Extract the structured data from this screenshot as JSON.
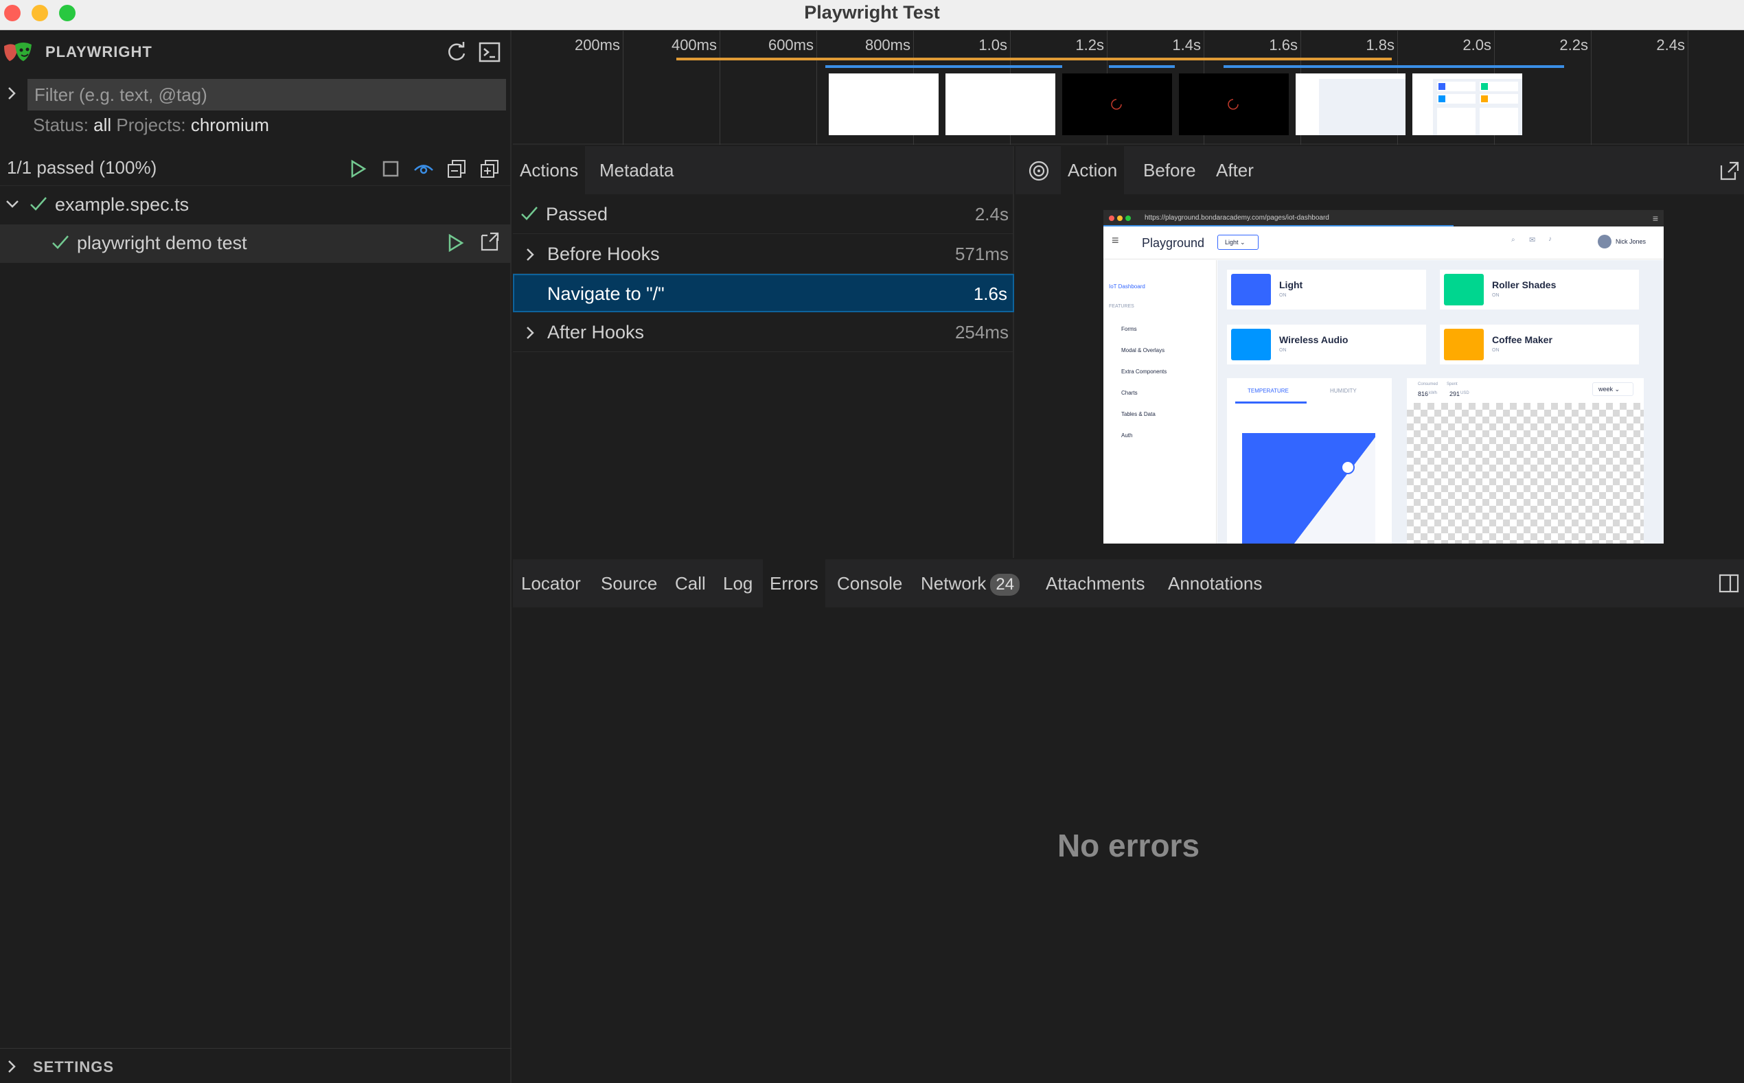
{
  "window": {
    "title": "Playwright Test"
  },
  "sidebar": {
    "brand": "PLAYWRIGHT",
    "filter_placeholder": "Filter (e.g. text, @tag)",
    "status_label": "Status:",
    "status_value": "all",
    "projects_label": "Projects:",
    "projects_value": "chromium",
    "summary": "1/1 passed (100%)",
    "tree": [
      {
        "label": "example.spec.ts",
        "status": "passed"
      },
      {
        "label": "playwright demo test",
        "status": "passed"
      }
    ],
    "settings_label": "SETTINGS"
  },
  "timeline": {
    "ticks": [
      "200ms",
      "400ms",
      "600ms",
      "800ms",
      "1.0s",
      "1.2s",
      "1.4s",
      "1.6s",
      "1.8s",
      "2.0s",
      "2.2s",
      "2.4s"
    ],
    "accent_orange": "#e09b36",
    "accent_blue": "#3a8ee6"
  },
  "actions_panel": {
    "tabs": [
      "Actions",
      "Metadata"
    ],
    "rows": [
      {
        "label": "Passed",
        "duration": "2.4s"
      },
      {
        "label": "Before Hooks",
        "duration": "571ms"
      },
      {
        "label": "Navigate to \"/\"",
        "duration": "1.6s"
      },
      {
        "label": "After Hooks",
        "duration": "254ms"
      }
    ],
    "selected_color": "#04395e"
  },
  "snapshot_panel": {
    "tabs": [
      "Action",
      "Before",
      "After"
    ],
    "page": {
      "url": "https://playground.bondaracademy.com/pages/iot-dashboard",
      "app_title": "Playground",
      "theme_select": "Light",
      "user": "Nick Jones",
      "side_menu": [
        "IoT Dashboard",
        "FEATURES",
        "Forms",
        "Modal & Overlays",
        "Extra Components",
        "Charts",
        "Tables & Data",
        "Auth"
      ],
      "cards": [
        {
          "title": "Light",
          "state": "ON"
        },
        {
          "title": "Roller Shades",
          "state": "ON"
        },
        {
          "title": "Wireless Audio",
          "state": "ON"
        },
        {
          "title": "Coffee Maker",
          "state": "ON"
        }
      ],
      "temp_tabs": [
        "TEMPERATURE",
        "HUMIDITY"
      ],
      "consumed_label": "Consumed",
      "spent_label": "Spent",
      "consumed_value": "816",
      "consumed_unit": "kWh",
      "spent_value": "291",
      "spent_unit": "USD",
      "period_select": "week"
    }
  },
  "bottom_panel": {
    "tabs": [
      "Locator",
      "Source",
      "Call",
      "Log",
      "Errors",
      "Console",
      "Network",
      "Attachments",
      "Annotations"
    ],
    "network_count": "24",
    "empty_message": "No errors"
  }
}
